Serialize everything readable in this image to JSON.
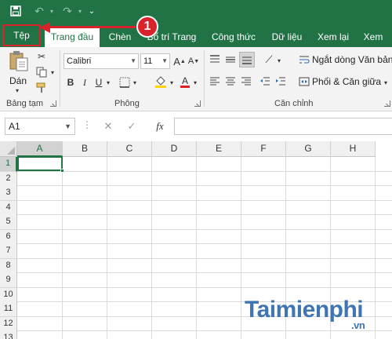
{
  "quick_access": {
    "save_icon": "save-icon",
    "undo_icon": "undo-icon",
    "redo_icon": "redo-icon",
    "customize_icon": "customize-qat-icon"
  },
  "tabs": [
    {
      "label": "Tệp",
      "name": "tab-file"
    },
    {
      "label": "Trang đầu",
      "name": "tab-home",
      "active": true
    },
    {
      "label": "Chèn",
      "name": "tab-insert"
    },
    {
      "label": "Bố trí Trang",
      "name": "tab-page-layout"
    },
    {
      "label": "Công thức",
      "name": "tab-formulas"
    },
    {
      "label": "Dữ liệu",
      "name": "tab-data"
    },
    {
      "label": "Xem lại",
      "name": "tab-review"
    },
    {
      "label": "Xem",
      "name": "tab-view"
    }
  ],
  "callout": {
    "number": "1",
    "color": "#d8232a"
  },
  "ribbon": {
    "clipboard": {
      "paste_label": "Dán",
      "group_label": "Bảng tạm"
    },
    "font": {
      "font_name": "Calibri",
      "font_size": "11",
      "bold": "B",
      "italic": "I",
      "underline": "U",
      "group_label": "Phông"
    },
    "alignment": {
      "wrap_text_label": "Ngắt dòng Văn bản",
      "merge_label": "Phối & Căn giữa",
      "group_label": "Căn chỉnh"
    }
  },
  "formula_bar": {
    "name_box": "A1",
    "cancel": "✕",
    "enter": "✓",
    "fx": "fx",
    "value": ""
  },
  "grid": {
    "columns": [
      "A",
      "B",
      "C",
      "D",
      "E",
      "F",
      "G",
      "H"
    ],
    "rows": [
      "1",
      "2",
      "3",
      "4",
      "5",
      "6",
      "7",
      "8",
      "9",
      "10",
      "11",
      "12",
      "13"
    ],
    "selected_cell": "A1"
  },
  "watermark": {
    "text": "Taimienphi",
    "suffix": ".vn"
  },
  "colors": {
    "accent": "#217346",
    "highlight": "#d8232a"
  }
}
